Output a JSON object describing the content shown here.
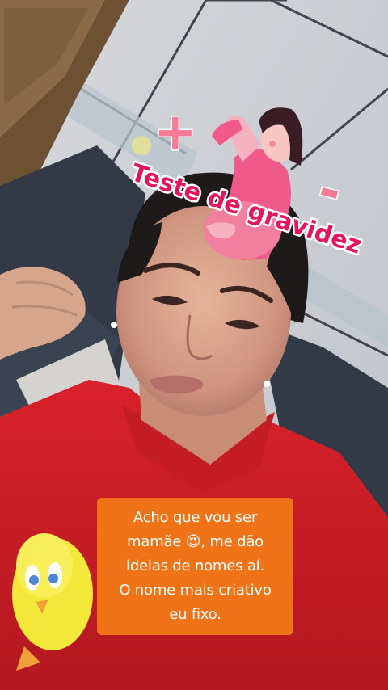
{
  "sticker": {
    "title": "Teste de gravidez",
    "plus_symbol": "+",
    "minus_symbol": "-",
    "icon": "pregnant-woman-icon"
  },
  "caption": {
    "lines": [
      "Acho que vou ser",
      "mamãe 😍, me dão",
      "ideias de nomes aí.",
      "O nome mais criativo",
      "eu fixo."
    ]
  },
  "colors": {
    "caption_background": "#f07318",
    "caption_text": "#ffffff",
    "sticker_text": "#e4155e",
    "sticker_symbols": "#f47a95",
    "shirt": "#d9212a",
    "sofa": "#323a48"
  }
}
